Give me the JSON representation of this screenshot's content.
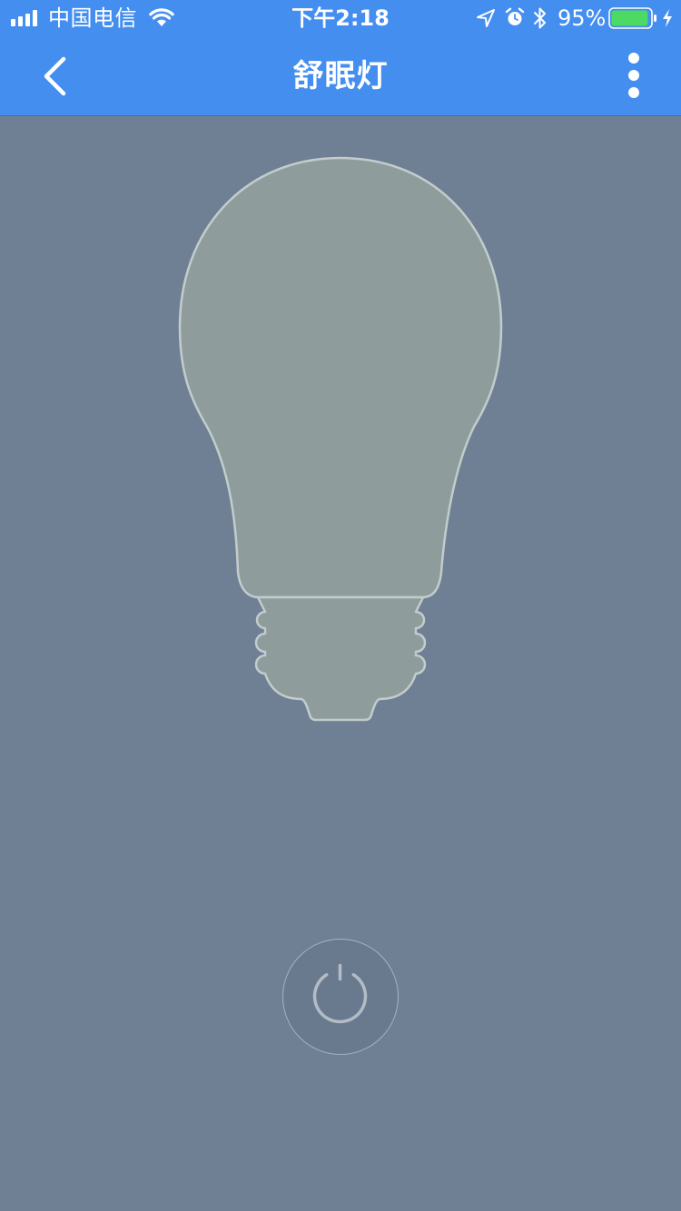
{
  "status_bar": {
    "carrier": "中国电信",
    "time": "下午2:18",
    "battery_percent": "95%",
    "battery_level": 0.95,
    "icons": [
      "signal-icon",
      "wifi-icon",
      "location-icon",
      "alarm-icon",
      "bluetooth-icon",
      "battery-icon",
      "charging-icon"
    ]
  },
  "nav": {
    "title": "舒眠灯",
    "back_icon": "chevron-left-icon",
    "more_icon": "more-vertical-icon"
  },
  "device": {
    "icon": "light-bulb-icon",
    "state": "off"
  },
  "power_button": {
    "icon": "power-icon"
  },
  "colors": {
    "header_bg": "#448ef0",
    "page_bg": "#6f7f94",
    "bulb_fill": "#8e9d9c",
    "bulb_outline": "#c2cccd",
    "power_stroke": "#a7b2bf",
    "battery_fill": "#4cd964"
  }
}
